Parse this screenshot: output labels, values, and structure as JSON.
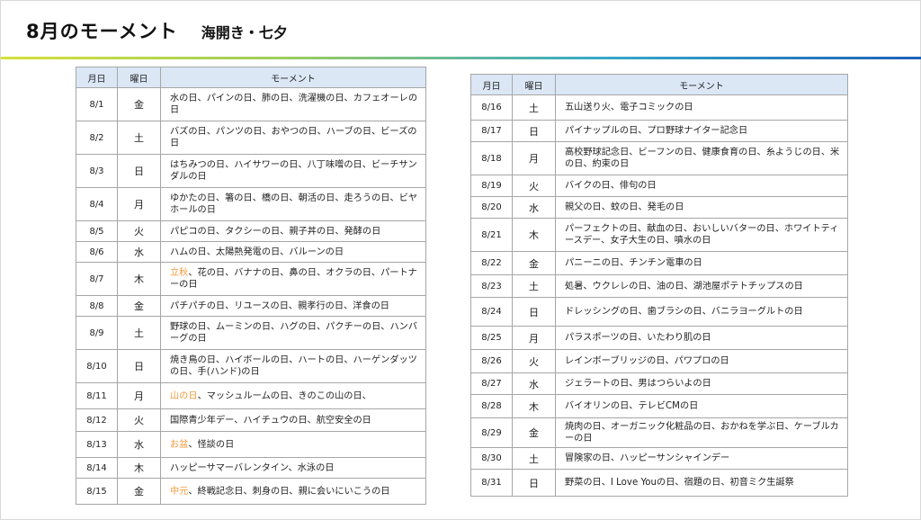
{
  "header": {
    "title": "8月のモーメント",
    "subtitle": "海開き・七夕"
  },
  "columns": {
    "date": "月日",
    "weekday": "曜日",
    "moment": "モーメント"
  },
  "colors": {
    "highlight": "#f39a3d",
    "header_fill": "#dbe7f5"
  },
  "left_table": [
    {
      "date": "8/1",
      "weekday": "金",
      "segments": [
        {
          "t": "水の日、パインの日、肺の日、洗濯機の日、カフェオーレの日"
        }
      ]
    },
    {
      "date": "8/2",
      "weekday": "土",
      "segments": [
        {
          "t": "バズの日、パンツの日、おやつの日、ハーブの日、ビーズの日"
        }
      ]
    },
    {
      "date": "8/3",
      "weekday": "日",
      "segments": [
        {
          "t": "はちみつの日、ハイサワーの日、八丁味噌の日、ビーチサンダルの日"
        }
      ]
    },
    {
      "date": "8/4",
      "weekday": "月",
      "segments": [
        {
          "t": "ゆかたの日、箸の日、橋の日、朝活の日、走ろうの日、ビヤホールの日"
        }
      ]
    },
    {
      "date": "8/5",
      "weekday": "火",
      "segments": [
        {
          "t": "パピコの日、タクシーの日、親子丼の日、発酵の日"
        }
      ]
    },
    {
      "date": "8/6",
      "weekday": "水",
      "segments": [
        {
          "t": "ハムの日、太陽熱発電の日、バルーンの日"
        }
      ]
    },
    {
      "date": "8/7",
      "weekday": "木",
      "segments": [
        {
          "t": "立秋",
          "hl": true
        },
        {
          "t": "、花の日、バナナの日、鼻の日、オクラの日、パートナーの日"
        }
      ]
    },
    {
      "date": "8/8",
      "weekday": "金",
      "segments": [
        {
          "t": "パチパチの日、リユースの日、親孝行の日、洋食の日"
        }
      ]
    },
    {
      "date": "8/9",
      "weekday": "土",
      "segments": [
        {
          "t": "野球の日、ムーミンの日、ハグの日、パクチーの日、ハンバーグの日"
        }
      ]
    },
    {
      "date": "8/10",
      "weekday": "日",
      "segments": [
        {
          "t": "焼き鳥の日、ハイボールの日、ハートの日、ハーゲンダッツの日、手(ハンド)の日"
        }
      ]
    },
    {
      "date": "8/11",
      "weekday": "月",
      "segments": [
        {
          "t": "山の日",
          "hl": true
        },
        {
          "t": "、マッシュルームの日、きのこの山の日、"
        }
      ]
    },
    {
      "date": "8/12",
      "weekday": "火",
      "segments": [
        {
          "t": "国際青少年デー、ハイチュウの日、航空安全の日"
        }
      ]
    },
    {
      "date": "8/13",
      "weekday": "水",
      "segments": [
        {
          "t": "お盆",
          "hl": true
        },
        {
          "t": "、怪談の日"
        }
      ]
    },
    {
      "date": "8/14",
      "weekday": "木",
      "segments": [
        {
          "t": "ハッピーサマーバレンタイン、水泳の日"
        }
      ]
    },
    {
      "date": "8/15",
      "weekday": "金",
      "segments": [
        {
          "t": "中元",
          "hl": true
        },
        {
          "t": "、終戦記念日、刺身の日、親に会いにいこうの日"
        }
      ]
    }
  ],
  "right_table": [
    {
      "date": "8/16",
      "weekday": "土",
      "segments": [
        {
          "t": "五山送り火、電子コミックの日"
        }
      ]
    },
    {
      "date": "8/17",
      "weekday": "日",
      "segments": [
        {
          "t": "パイナップルの日、プロ野球ナイター記念日"
        }
      ]
    },
    {
      "date": "8/18",
      "weekday": "月",
      "segments": [
        {
          "t": "高校野球記念日、ビーフンの日、健康食育の日、糸ようじの日、米の日、約束の日"
        }
      ]
    },
    {
      "date": "8/19",
      "weekday": "火",
      "segments": [
        {
          "t": "バイクの日、俳句の日"
        }
      ]
    },
    {
      "date": "8/20",
      "weekday": "水",
      "segments": [
        {
          "t": "親父の日、蚊の日、発毛の日"
        }
      ]
    },
    {
      "date": "8/21",
      "weekday": "木",
      "segments": [
        {
          "t": "パーフェクトの日、献血の日、おいしいバターの日、ホワイトティースデー、女子大生の日、噴水の日"
        }
      ]
    },
    {
      "date": "8/22",
      "weekday": "金",
      "segments": [
        {
          "t": "パニーニの日、チンチン電車の日"
        }
      ]
    },
    {
      "date": "8/23",
      "weekday": "土",
      "segments": [
        {
          "t": "処暑、ウクレレの日、油の日、湖池屋ポテトチップスの日"
        }
      ]
    },
    {
      "date": "8/24",
      "weekday": "日",
      "segments": [
        {
          "t": "ドレッシングの日、歯ブラシの日、バニラヨーグルトの日"
        }
      ]
    },
    {
      "date": "8/25",
      "weekday": "月",
      "segments": [
        {
          "t": "パラスポーツの日、いたわり肌の日"
        }
      ]
    },
    {
      "date": "8/26",
      "weekday": "火",
      "segments": [
        {
          "t": "レインボーブリッジの日、パワプロの日"
        }
      ]
    },
    {
      "date": "8/27",
      "weekday": "水",
      "segments": [
        {
          "t": "ジェラートの日、男はつらいよの日"
        }
      ]
    },
    {
      "date": "8/28",
      "weekday": "木",
      "segments": [
        {
          "t": "バイオリンの日、テレビCMの日"
        }
      ]
    },
    {
      "date": "8/29",
      "weekday": "金",
      "segments": [
        {
          "t": "焼肉の日、オーガニック化粧品の日、おかねを学ぶ日、ケーブルカーの日"
        }
      ]
    },
    {
      "date": "8/30",
      "weekday": "土",
      "segments": [
        {
          "t": "冒険家の日、ハッピーサンシャインデー"
        }
      ]
    },
    {
      "date": "8/31",
      "weekday": "日",
      "segments": [
        {
          "t": "野菜の日、I Love Youの日、宿題の日、初音ミク生誕祭"
        }
      ]
    }
  ]
}
